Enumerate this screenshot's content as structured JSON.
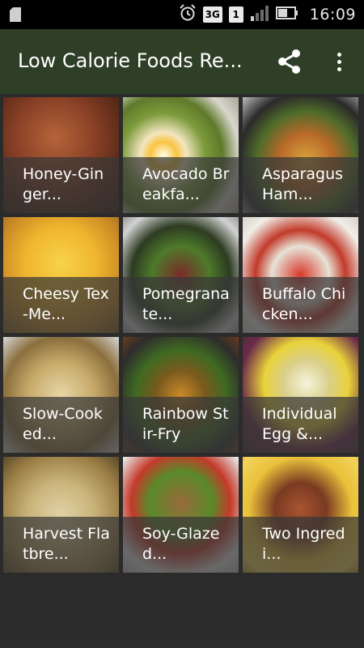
{
  "status_bar": {
    "time": "16:09",
    "network": "3G",
    "sim_slot": "1",
    "icons": [
      "sd-card-icon",
      "alarm-icon",
      "network-3g-icon",
      "sim-icon",
      "signal-icon",
      "battery-icon"
    ]
  },
  "app_bar": {
    "title": "Low Calorie Foods Re...",
    "actions": [
      "share-icon",
      "more-vert-icon"
    ],
    "color": "#2f3f27"
  },
  "recipes": [
    {
      "title": "Honey-Ginger..."
    },
    {
      "title": "Avocado Breakfa..."
    },
    {
      "title": "Asparagus Ham..."
    },
    {
      "title": "Cheesy Tex-Me..."
    },
    {
      "title": "Pomegranate..."
    },
    {
      "title": "Buffalo Chicken..."
    },
    {
      "title": "Slow-Cooked..."
    },
    {
      "title": "Rainbow Stir-Fry"
    },
    {
      "title": "Individual Egg &..."
    },
    {
      "title": "Harvest Flatbre..."
    },
    {
      "title": "Soy-Glazed..."
    },
    {
      "title": "Two Ingredi..."
    }
  ]
}
